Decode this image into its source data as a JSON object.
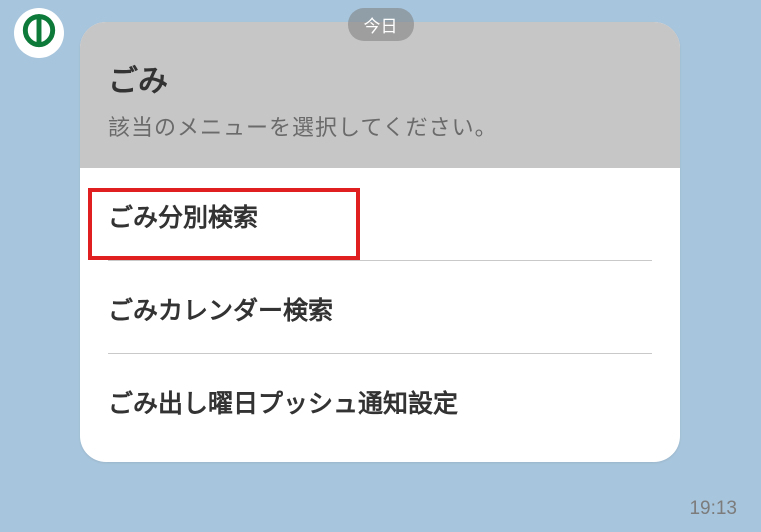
{
  "date_label": "今日",
  "avatar": {
    "icon": "logo"
  },
  "card": {
    "title": "ごみ",
    "subtitle": "該当のメニューを選択してください。"
  },
  "menu": {
    "items": [
      {
        "label": "ごみ分別検索"
      },
      {
        "label": "ごみカレンダー検索"
      },
      {
        "label": "ごみ出し曜日プッシュ通知設定"
      }
    ]
  },
  "timestamp": "19:13"
}
